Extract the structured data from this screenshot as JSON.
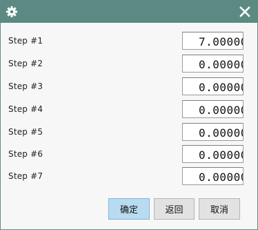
{
  "dialog": {
    "icons": {
      "settings": "gear-icon",
      "close": "close-icon"
    },
    "colors": {
      "titlebar": "#5b8a82",
      "primary_button": "#b9dbf1",
      "button": "#e2e2e2"
    }
  },
  "steps": [
    {
      "label": "Step #1",
      "value": "7.00000"
    },
    {
      "label": "Step #2",
      "value": "0.00000"
    },
    {
      "label": "Step #3",
      "value": "0.00000"
    },
    {
      "label": "Step #4",
      "value": "0.00000"
    },
    {
      "label": "Step #5",
      "value": "0.00000"
    },
    {
      "label": "Step #6",
      "value": "0.00000"
    },
    {
      "label": "Step #7",
      "value": "0.00000"
    }
  ],
  "buttons": {
    "ok": "确定",
    "back": "返回",
    "cancel": "取消"
  }
}
